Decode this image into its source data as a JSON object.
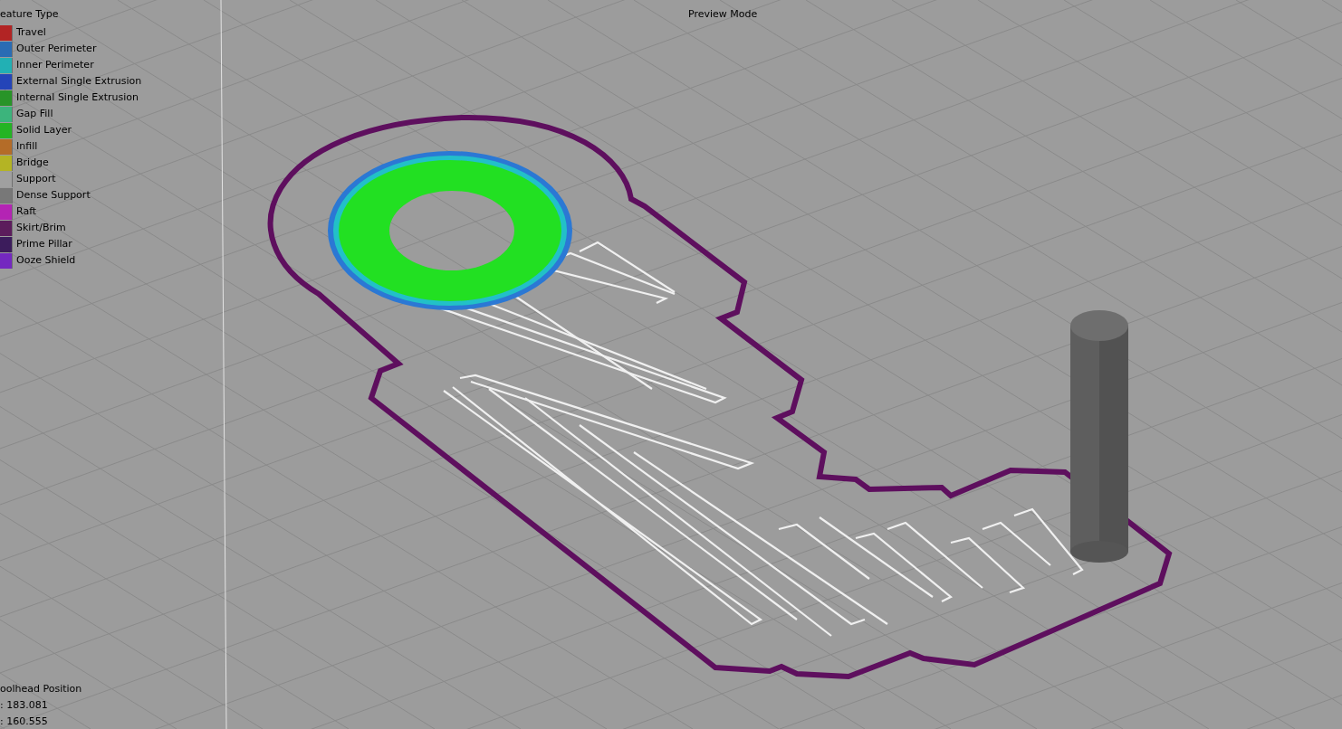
{
  "legend": {
    "title": "eature Type",
    "items": [
      {
        "label": "Travel",
        "color": "#b22424"
      },
      {
        "label": "Outer Perimeter",
        "color": "#2a6cb4"
      },
      {
        "label": "Inner Perimeter",
        "color": "#22b0b4"
      },
      {
        "label": "External Single Extrusion",
        "color": "#2444b8"
      },
      {
        "label": "Internal Single Extrusion",
        "color": "#289428"
      },
      {
        "label": "Gap Fill",
        "color": "#3cb47c"
      },
      {
        "label": "Solid Layer",
        "color": "#24b424"
      },
      {
        "label": "Infill",
        "color": "#b46c28"
      },
      {
        "label": "Bridge",
        "color": "#b4b424"
      },
      {
        "label": "Support",
        "color": "#a0a0a0"
      },
      {
        "label": "Dense Support",
        "color": "#787878"
      },
      {
        "label": "Raft",
        "color": "#b424b4"
      },
      {
        "label": "Skirt/Brim",
        "color": "#5c1c5c"
      },
      {
        "label": "Prime Pillar",
        "color": "#3c1c5c"
      },
      {
        "label": "Ooze Shield",
        "color": "#7428c0"
      }
    ]
  },
  "mode": "Preview Mode",
  "toolhead": {
    "title": "oolhead Position",
    "lines": [
      ": 183.081",
      ": 160.555"
    ]
  }
}
